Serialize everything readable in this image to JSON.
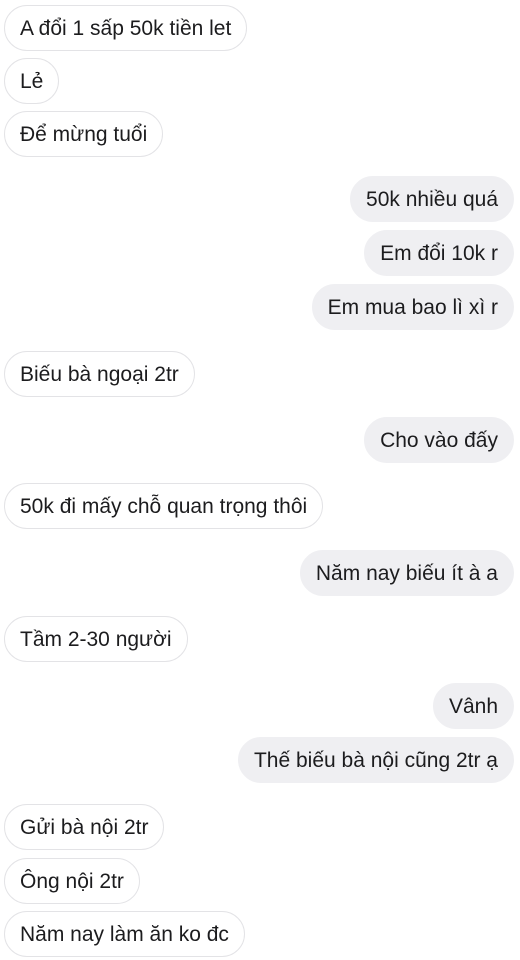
{
  "messages": [
    {
      "side": "incoming",
      "text": "A đổi 1 sấp 50k tiền let"
    },
    {
      "side": "incoming",
      "text": "Lẻ"
    },
    {
      "side": "incoming",
      "text": "Để mừng tuổi"
    },
    {
      "side": "outgoing",
      "text": "50k nhiều quá"
    },
    {
      "side": "outgoing",
      "text": "Em đổi 10k r"
    },
    {
      "side": "outgoing",
      "text": "Em mua bao lì xì r"
    },
    {
      "side": "incoming",
      "text": "Biếu bà ngoại 2tr"
    },
    {
      "side": "outgoing",
      "text": "Cho vào đấy"
    },
    {
      "side": "incoming",
      "text": "50k đi mấy chỗ quan trọng thôi"
    },
    {
      "side": "outgoing",
      "text": "Năm nay biếu ít à a"
    },
    {
      "side": "incoming",
      "text": "Tầm 2-30 người"
    },
    {
      "side": "outgoing",
      "text": "Vânh"
    },
    {
      "side": "outgoing",
      "text": "Thế biếu bà nội cũng 2tr ạ"
    },
    {
      "side": "incoming",
      "text": "Gửi bà nội 2tr"
    },
    {
      "side": "incoming",
      "text": "Ông nội 2tr"
    },
    {
      "side": "incoming",
      "text": "Năm nay làm ăn ko đc"
    }
  ]
}
